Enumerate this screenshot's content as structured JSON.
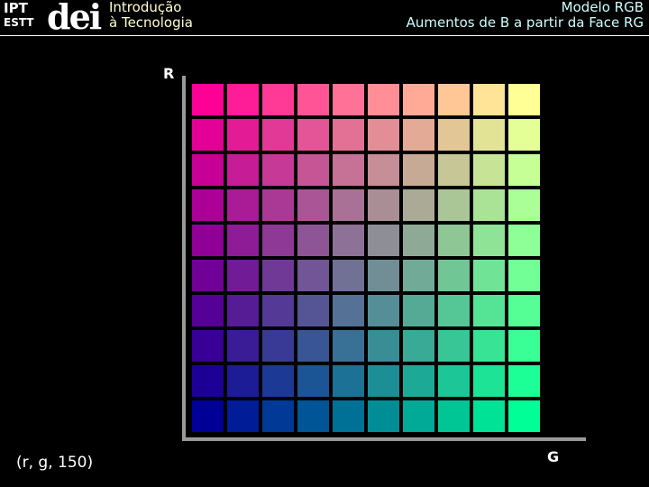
{
  "header": {
    "logo_text": {
      "top": "IPT",
      "bottom": "ESTT",
      "brand": "dei"
    },
    "course_line1": "Introdução",
    "course_line2": "à Tecnologia",
    "title_line1": "Modelo RGB",
    "title_line2": "Aumentos de B a partir da Face RG"
  },
  "diagram": {
    "axis_vertical_label": "R",
    "axis_horizontal_label": "G",
    "fixed_component_note": "(r, g, 150)",
    "blue_value": 150,
    "steps": [
      0,
      28,
      57,
      85,
      113,
      142,
      170,
      198,
      227,
      255
    ],
    "axis_color": "#999999"
  }
}
